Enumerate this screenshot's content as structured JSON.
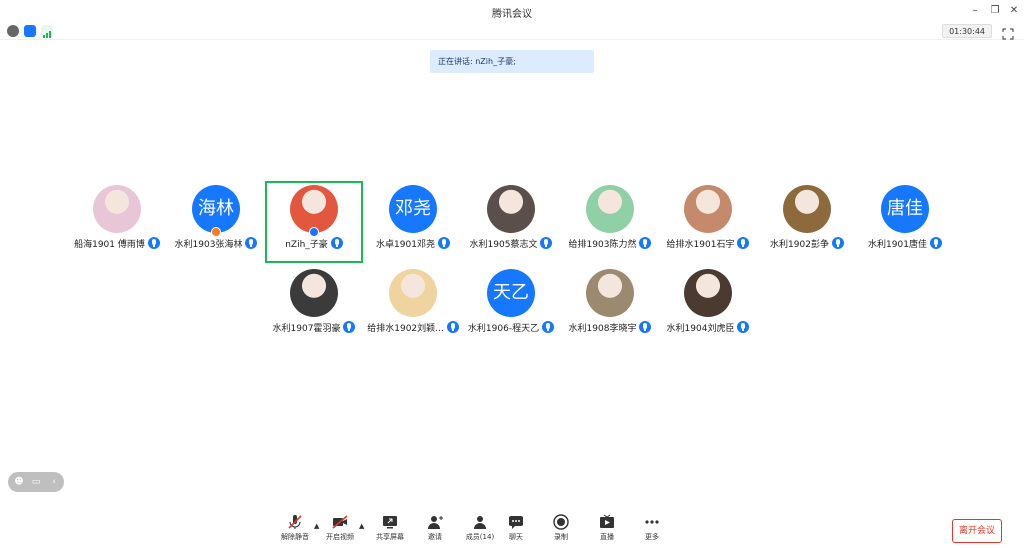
{
  "window": {
    "title": "腾讯会议"
  },
  "status": {
    "timer": "01:30:44"
  },
  "banner": {
    "speaking": "正在讲话: nZih_子豪;"
  },
  "participants": [
    {
      "name": "船海1901 傅雨博",
      "avatar_text": "",
      "avatar_color": "#e8c6d8"
    },
    {
      "name": "水利1903张海林",
      "avatar_text": "海林",
      "avatar_color": "#1677ff"
    },
    {
      "name": "nZih_子豪",
      "avatar_text": "",
      "avatar_color": "#e3573f"
    },
    {
      "name": "水卓1901邓尧",
      "avatar_text": "邓尧",
      "avatar_color": "#1677ff"
    },
    {
      "name": "水利1905蔡志文",
      "avatar_text": "",
      "avatar_color": "#5a4f4a"
    },
    {
      "name": "给排1903陈力然",
      "avatar_text": "",
      "avatar_color": "#8fd0a6"
    },
    {
      "name": "给排水1901石宇",
      "avatar_text": "",
      "avatar_color": "#c58a6b"
    },
    {
      "name": "水利1902彭争",
      "avatar_text": "",
      "avatar_color": "#8c6a3c"
    },
    {
      "name": "水利1901唐佳",
      "avatar_text": "唐佳",
      "avatar_color": "#1677ff"
    },
    {
      "name": "水利1907霍羽豪",
      "avatar_text": "",
      "avatar_color": "#3b3b3b"
    },
    {
      "name": "给排水1902刘颖...",
      "avatar_text": "",
      "avatar_color": "#f0d4a0"
    },
    {
      "name": "水利1906-程天乙",
      "avatar_text": "天乙",
      "avatar_color": "#1677ff"
    },
    {
      "name": "水利1908李晓宇",
      "avatar_text": "",
      "avatar_color": "#9b8a70"
    },
    {
      "name": "水利1904刘虎臣",
      "avatar_text": "",
      "avatar_color": "#4a3a30"
    }
  ],
  "toolbar": {
    "unmute": "解除静音",
    "start_video": "开启视频",
    "share": "共享屏幕",
    "invite": "邀请",
    "members": "成员(14)",
    "chat": "聊天",
    "record": "录制",
    "live": "直播",
    "more": "更多",
    "leave": "离开会议"
  }
}
